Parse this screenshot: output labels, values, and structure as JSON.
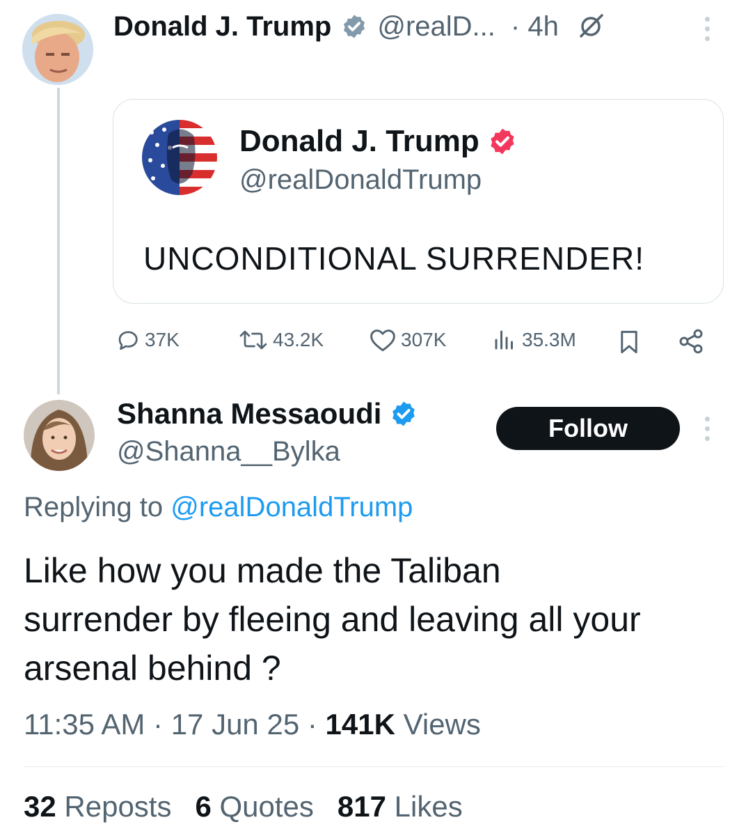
{
  "original_post": {
    "author_name": "Donald J. Trump",
    "handle_truncated": "@realD...",
    "time": "· 4h",
    "quoted": {
      "author_name": "Donald J. Trump",
      "handle": "@realDonaldTrump",
      "text": "UNCONDITIONAL SURRENDER!"
    },
    "actions": {
      "replies": "37K",
      "reposts": "43.2K",
      "likes": "307K",
      "views": "35.3M"
    }
  },
  "reply": {
    "author_name": "Shanna Messaoudi",
    "handle": "@Shanna__Bylka",
    "follow_label": "Follow",
    "replying_to_prefix": "Replying to",
    "replying_to_handle": "@realDonaldTrump",
    "text_lines": [
      "Like how you made the Taliban",
      "surrender by fleeing and leaving all your",
      "arsenal behind ?"
    ],
    "time": "11:35 AM",
    "date": "17 Jun 25",
    "views_count": "141K",
    "views_label": "Views"
  },
  "stats": {
    "reposts_count": "32",
    "reposts_label": "Reposts",
    "quotes_count": "6",
    "quotes_label": "Quotes",
    "likes_count": "817",
    "likes_label": "Likes"
  },
  "colors": {
    "verified_blue": "#1d9bf0",
    "verified_red": "#f4375c",
    "text": "#0f1419",
    "muted": "#536471"
  },
  "icons": [
    "verified-badge-icon",
    "grok-icon",
    "more-options-icon",
    "reply-icon",
    "repost-icon",
    "like-icon",
    "views-icon",
    "bookmark-icon",
    "share-icon"
  ]
}
